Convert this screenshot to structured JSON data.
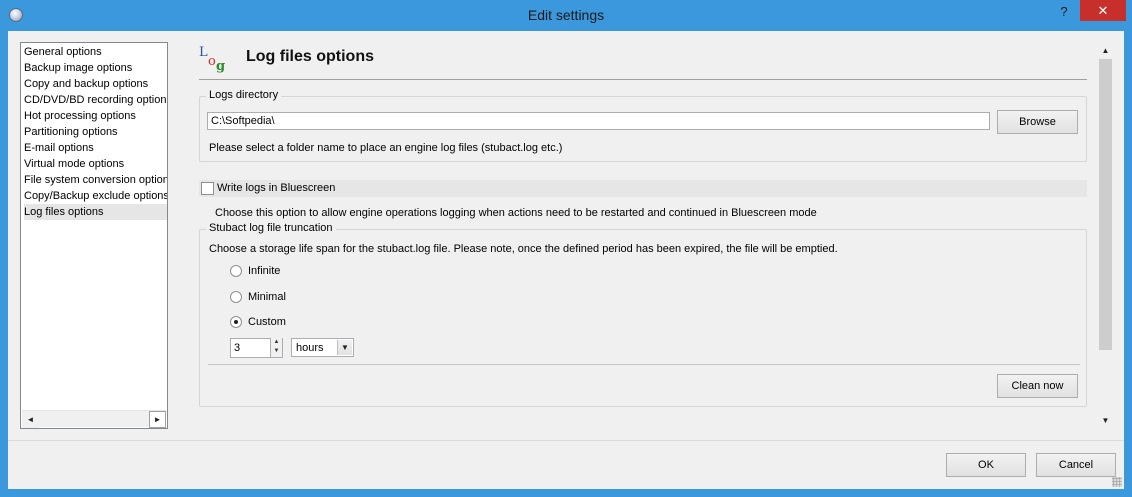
{
  "window": {
    "title": "Edit settings",
    "help_glyph": "?",
    "close_glyph": "✕"
  },
  "sidebar": {
    "items": [
      {
        "label": "General options",
        "selected": false
      },
      {
        "label": "Backup image options",
        "selected": false
      },
      {
        "label": "Copy and backup options",
        "selected": false
      },
      {
        "label": "CD/DVD/BD recording options",
        "selected": false
      },
      {
        "label": "Hot processing options",
        "selected": false
      },
      {
        "label": "Partitioning options",
        "selected": false
      },
      {
        "label": "E-mail options",
        "selected": false
      },
      {
        "label": "Virtual mode options",
        "selected": false
      },
      {
        "label": "File system conversion options",
        "selected": false
      },
      {
        "label": "Copy/Backup exclude options",
        "selected": false
      },
      {
        "label": "Log files options",
        "selected": true
      }
    ],
    "scroll_left_glyph": "◄",
    "scroll_right_glyph": "►"
  },
  "page": {
    "logo_text": {
      "l": "L",
      "o": "o",
      "g": "g"
    },
    "title": "Log files options",
    "logs_directory": {
      "legend": "Logs directory",
      "path_value": "C:\\Softpedia\\",
      "browse_label": "Browse",
      "hint": "Please select a folder name to place an engine log files (stubact.log etc.)"
    },
    "bluescreen": {
      "checkbox_label": "Write logs in Bluescreen",
      "checked": false,
      "description": "Choose this option to allow engine operations logging when actions need to be restarted and continued in Bluescreen mode"
    },
    "truncation": {
      "legend": "Stubact log file truncation",
      "description": "Choose a storage life span for the stubact.log file. Please note, once the defined period has been expired, the file will be emptied.",
      "options": [
        {
          "label": "Infinite",
          "checked": false
        },
        {
          "label": "Minimal",
          "checked": false
        },
        {
          "label": "Custom",
          "checked": true
        }
      ],
      "amount_value": "3",
      "unit_value": "hours",
      "clean_label": "Clean now"
    }
  },
  "scrollbar": {
    "up_glyph": "▲",
    "down_glyph": "▼"
  },
  "footer": {
    "ok_label": "OK",
    "cancel_label": "Cancel"
  },
  "colors": {
    "titlebar": "#3b98dc",
    "close_button": "#c7302a",
    "dialog_bg": "#f0f0f0",
    "selection": "#e6e6e6"
  }
}
